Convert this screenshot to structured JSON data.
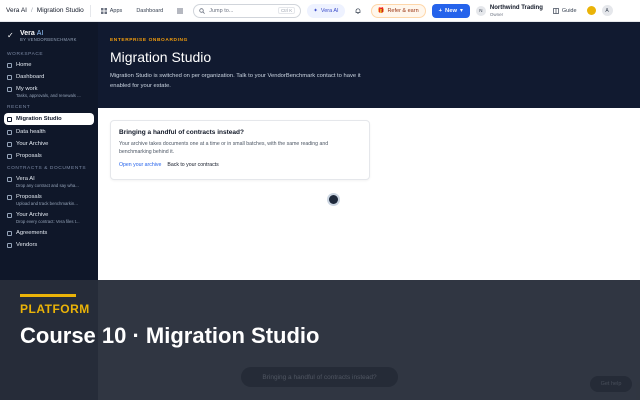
{
  "topbar": {
    "app_name": "Vera AI",
    "separator": "/",
    "page_name": "Migration Studio",
    "apps_label": "Apps",
    "dashboard_label": "Dashboard",
    "search_placeholder": "Jump to...",
    "search_shortcut": "Ctrl K",
    "vera_label": "Vera AI",
    "refer_label": "Refer & earn",
    "new_label": "New",
    "org_initial": "N",
    "org_name": "Northwind Trading",
    "org_role": "Owner",
    "guide_label": "Guide",
    "avatar_initial": "A"
  },
  "sidebar": {
    "brand_name": "Vera",
    "brand_suffix": "AI",
    "brand_sub": "BY VENDORBENCHMARK",
    "sections": {
      "workspace": "WORKSPACE",
      "recent": "RECENT",
      "contracts": "CONTRACTS & DOCUMENTS"
    },
    "workspace_items": [
      {
        "label": "Home",
        "sub": ""
      },
      {
        "label": "Dashboard",
        "sub": ""
      },
      {
        "label": "My work",
        "sub": "Tasks, approvals, and renewals ..."
      }
    ],
    "recent_items": [
      {
        "label": "Migration Studio",
        "sub": ""
      },
      {
        "label": "Data health",
        "sub": ""
      },
      {
        "label": "Your Archive",
        "sub": ""
      },
      {
        "label": "Proposals",
        "sub": ""
      }
    ],
    "contract_items": [
      {
        "label": "Vera AI",
        "sub": "Drop any contract and say wha..."
      },
      {
        "label": "Proposals",
        "sub": "Upload and track benchmarkin..."
      },
      {
        "label": "Your Archive",
        "sub": "Drop every contract: Vera files t..."
      },
      {
        "label": "Agreements",
        "sub": ""
      },
      {
        "label": "Vendors",
        "sub": ""
      }
    ]
  },
  "hero": {
    "eyebrow": "ENTERPRISE ONBOARDING",
    "title": "Migration Studio",
    "description": "Migration Studio is switched on per organization. Talk to your VendorBenchmark contact to have it enabled for your estate."
  },
  "card": {
    "title": "Bringing a handful of contracts instead?",
    "body": "Your archive takes documents one at a time or in small batches, with the same reading and benchmarking behind it.",
    "link_primary": "Open your archive",
    "link_secondary": "Back to your contracts"
  },
  "overlay": {
    "tag": "PLATFORM",
    "title": "Course 10 · Migration Studio",
    "ghost_pill": "Bringing a handful of contracts instead?",
    "ghost_help": "Get help"
  },
  "colors": {
    "sidebar_bg": "#0f1729",
    "hero_bg": "#111a30",
    "accent": "#2563eb",
    "gold": "#eab308"
  }
}
